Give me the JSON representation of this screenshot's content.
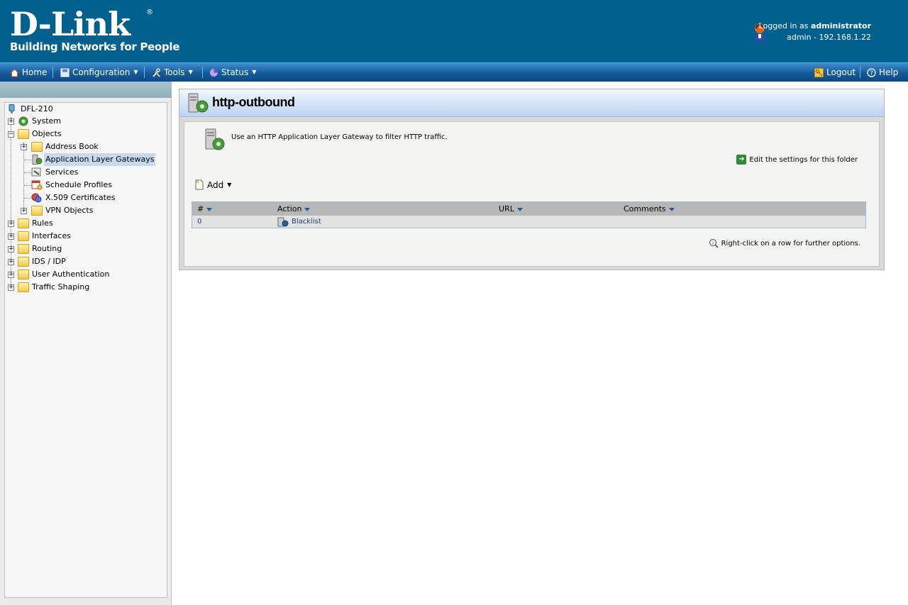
{
  "header": {
    "brand": "D-Link",
    "reg": "®",
    "tagline": "Building Networks for People",
    "logged_in_prefix": "Logged in as",
    "logged_in_user": "administrator",
    "session": "admin - 192.168.1.22"
  },
  "menubar": {
    "home": "Home",
    "configuration": "Configuration",
    "tools": "Tools",
    "status": "Status",
    "logout": "Logout",
    "help": "Help"
  },
  "tree": {
    "root": "DFL-210",
    "system": "System",
    "objects": "Objects",
    "address_book": "Address Book",
    "alg": "Application Layer Gateways",
    "services": "Services",
    "schedule_profiles": "Schedule Profiles",
    "x509": "X.509 Certificates",
    "vpn_objects": "VPN Objects",
    "rules": "Rules",
    "interfaces": "Interfaces",
    "routing": "Routing",
    "ids_idp": "IDS / IDP",
    "user_auth": "User Authentication",
    "traffic_shaping": "Traffic Shaping"
  },
  "main": {
    "title": "http-outbound",
    "description": "Use an HTTP Application Layer Gateway to filter HTTP traffic.",
    "edit_link": "Edit the settings for this folder",
    "add_label": "Add",
    "columns": [
      "#",
      "Action",
      "URL",
      "Comments"
    ],
    "rows": [
      {
        "index": "0",
        "action": "Blacklist",
        "url": "",
        "comments": ""
      }
    ],
    "hint": "Right-click on a row for further options."
  },
  "colors": {
    "header_bg": "#02608f",
    "menubar_bg": "#135a9a",
    "selected_bg": "#c7d9ef"
  }
}
